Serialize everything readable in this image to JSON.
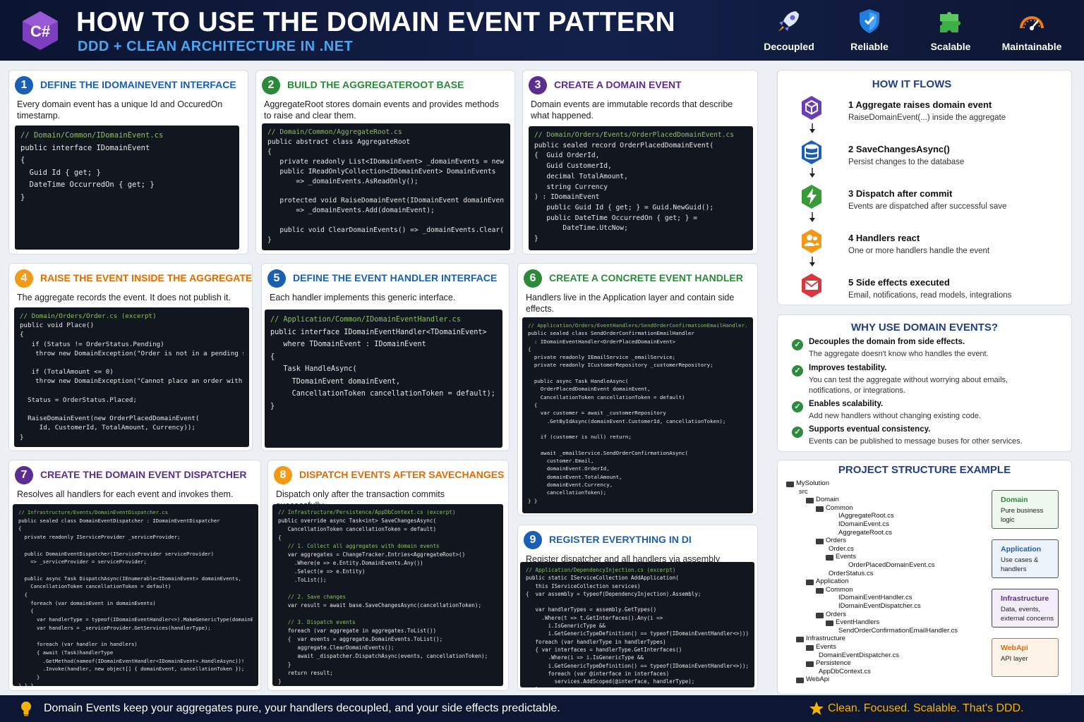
{
  "header": {
    "logo_text": "C#",
    "title": "HOW TO USE THE DOMAIN EVENT PATTERN",
    "subtitle": "DDD + CLEAN ARCHITECTURE IN .NET",
    "badges": [
      {
        "label": "Decoupled",
        "icon": "rocket-icon"
      },
      {
        "label": "Reliable",
        "icon": "shield-icon"
      },
      {
        "label": "Scalable",
        "icon": "puzzle-icon"
      },
      {
        "label": "Maintainable",
        "icon": "gauge-icon"
      }
    ]
  },
  "colors": {
    "blue": "#1a5fb4",
    "green": "#2a8a3a",
    "purple": "#5b2d91",
    "orange": "#e06c00",
    "red": "#c9302c",
    "navy": "#0d1633",
    "gold": "#f4b400"
  },
  "cards": [
    {
      "num": "1",
      "title": "DEFINE THE IDOMAINEVENT INTERFACE",
      "desc": "Every domain event has a unique Id and OccuredOn timestamp.",
      "code": [
        "// Domain/Common/IDomainEvent.cs",
        "public interface IDomainEvent",
        "{",
        "  Guid Id { get; }",
        "  DateTime OccurredOn { get; }",
        "}"
      ]
    },
    {
      "num": "2",
      "title": "BUILD THE AGGREGATEROOT BASE",
      "desc": "AggregateRoot stores domain events and provides methods to raise and clear them.",
      "code": [
        "// Domain/Common/AggregateRoot.cs",
        "public abstract class AggregateRoot",
        "{",
        "   private readonly List<IDomainEvent> _domainEvents = new();",
        "   public IReadOnlyCollection<IDomainEvent> DomainEvents",
        "       => _domainEvents.AsReadOnly();",
        "",
        "   protected void RaiseDomainEvent(IDomainEvent domainEvent)",
        "       => _domainEvents.Add(domainEvent);",
        "",
        "   public void ClearDomainEvents() => _domainEvents.Clear();",
        "}"
      ]
    },
    {
      "num": "3",
      "title": "CREATE A DOMAIN EVENT",
      "desc": "Domain events are immutable records that describe what happened.",
      "code": [
        "// Domain/Orders/Events/OrderPlacedDomainEvent.cs",
        "public sealed record OrderPlacedDomainEvent(",
        "{  Guid OrderId,",
        "   Guid CustomerId,",
        "   decimal TotalAmount,",
        "   string Currency",
        ") : IDomainEvent",
        "   public Guid Id { get; } = Guid.NewGuid();",
        "   public DateTime OccurredOn { get; } =",
        "       DateTime.UtcNow;",
        "}"
      ]
    },
    {
      "num": "4",
      "title": "RAISE THE EVENT INSIDE THE AGGREGATE ROOT",
      "desc": "The aggregate records the event. It does not publish it.",
      "code": [
        "// Domain/Orders/Order.cs (excerpt)",
        "public void Place()",
        "{",
        "   if (Status != OrderStatus.Pending)",
        "    throw new DomainException(\"Order is not in a pending state.\");",
        "",
        "   if (TotalAmount <= 0)",
        "    throw new DomainException(\"Cannot place an order with no items.\");",
        "",
        "  Status = OrderStatus.Placed;",
        "",
        "  RaiseDomainEvent(new OrderPlacedDomainEvent(",
        "     Id, CustomerId, TotalAmount, Currency));",
        "}"
      ]
    },
    {
      "num": "5",
      "title": "DEFINE THE EVENT HANDLER INTERFACE",
      "desc": "Each handler implements this generic interface.",
      "code": [
        "// Application/Common/IDomainEventHandler.cs",
        "public interface IDomainEventHandler<TDomainEvent>",
        "   where TDomainEvent : IDomainEvent",
        "{",
        "   Task HandleAsync(",
        "     TDomainEvent domainEvent,",
        "     CancellationToken cancellationToken = default);",
        "}"
      ]
    },
    {
      "num": "6",
      "title": "CREATE A CONCRETE EVENT HANDLER",
      "desc": "Handlers live in the Application layer and contain side effects.",
      "code": [
        "// Application/Orders/EventHandlers/SendOrderConfirmationEmailHandler.cs",
        "public sealed class SendOrderConfirmationEmailHandler",
        "  : IDomainEventHandler<OrderPlacedDomainEvent>",
        "{",
        "  private readonly IEmailService _emailService;",
        "  private readonly ICustomerRepository _customerRepository;",
        "",
        "  public async Task HandleAsync(",
        "    OrderPlacedDomainEvent domainEvent,",
        "    CancellationToken cancellationToken = default)",
        "  {",
        "    var customer = await _customerRepository",
        "      .GetByIdAsync(domainEvent.CustomerId, cancellationToken);",
        "",
        "    if (customer is null) return;",
        "",
        "    await _emailService.SendOrderConfirmationAsync(",
        "      customer.Email,",
        "      domainEvent.OrderId,",
        "      domainEvent.TotalAmount,",
        "      domainEvent.Currency,",
        "      cancellationToken);",
        "} }"
      ]
    },
    {
      "num": "7",
      "title": "CREATE THE DOMAIN EVENT DISPATCHER",
      "desc": "Resolves all handlers for each event and invokes them.",
      "code": [
        "// Infrastructure/Events/DomainEventDispatcher.cs",
        "public sealed class DomainEventDispatcher : IDomainEventDispatcher",
        "{",
        "  private readonly IServiceProvider _serviceProvider;",
        "",
        "  public DomainEventDispatcher(IServiceProvider serviceProvider)",
        "    => _serviceProvider = serviceProvider;",
        "",
        "  public async Task DispatchAsync(IEnumerable<IDomainEvent> domainEvents,",
        "    CancellationToken cancellationToken = default)",
        "  {",
        "    foreach (var domainEvent in domainEvents)",
        "    {",
        "      var handlerType = typeof(IDomainEventHandler<>).MakeGenericType(domainEvent.GetType());",
        "      var handlers = _serviceProvider.GetServices(handlerType);",
        "",
        "      foreach (var handler in handlers)",
        "      { await (Task)handlerType",
        "        .GetMethod(nameof(IDomainEventHandler<IDomainEvent>.HandleAsync))!",
        "        .Invoke(handler, new object[] { domainEvent, cancellationToken });",
        "      }",
        "} } }"
      ]
    },
    {
      "num": "8",
      "title": "DISPATCH EVENTS AFTER SAVECHANGES",
      "desc": "Dispatch only after the transaction commits successfully.",
      "code": [
        "// Infrastructure/Persistence/AppDbContext.cs (excerpt)",
        "public override async Task<int> SaveChangesAsync(",
        "   CancellationToken cancellationToken = default)",
        "{",
        "   // 1. Collect all aggregates with domain events",
        "   var aggregates = ChangeTracker.Entries<AggregateRoot>()",
        "     .Where(e => e.Entity.DomainEvents.Any())",
        "     .Select(e => e.Entity)",
        "     .ToList();",
        "",
        "   // 2. Save changes",
        "   var result = await base.SaveChangesAsync(cancellationToken);",
        "",
        "   // 3. Dispatch events",
        "   foreach (var aggregate in aggregates.ToList())",
        "   {  var events = aggregate.DomainEvents.ToList();",
        "      aggregate.ClearDomainEvents();",
        "      await _dispatcher.DispatchAsync(events, cancellationToken);",
        "   }",
        "   return result;",
        "}"
      ]
    },
    {
      "num": "9",
      "title": "REGISTER EVERYTHING IN DI",
      "desc": "Register dispatcher and all handlers via assembly scanning.",
      "code": [
        "// Application/DependencyInjection.cs (excerpt)",
        "public static IServiceCollection AddApplication(",
        "   this IServiceCollection services)",
        "{  var assembly = typeof(DependencyInjection).Assembly;",
        "",
        "   var handlerTypes = assembly.GetTypes()",
        "     .Where(t => t.GetInterfaces().Any(i =>",
        "       i.IsGenericType &&",
        "       i.GetGenericTypeDefinition() == typeof(IDomainEventHandler<>)));",
        "   foreach (var handlerType in handlerTypes)",
        "   { var interfaces = handlerType.GetInterfaces()",
        "       .Where(i => i.IsGenericType &&",
        "       i.GetGenericTypeDefinition() == typeof(IDomainEventHandler<>));",
        "       foreach (var @interface in interfaces)",
        "         services.AddScoped(@interface, handlerType);",
        "   }"
      ]
    }
  ],
  "flows": {
    "title": "HOW IT FLOWS",
    "steps": [
      {
        "label": "1  Aggregate raises domain event",
        "desc": "RaiseDomainEvent(...) inside the aggregate",
        "icon": "cube-icon",
        "color": "#6a3fb5"
      },
      {
        "label": "2  SaveChangesAsync()",
        "desc": "Persist changes to the database",
        "icon": "database-icon",
        "color": "#1a5fb4"
      },
      {
        "label": "3  Dispatch after commit",
        "desc": "Events are dispatched after successful save",
        "icon": "lightning-icon",
        "color": "#3a9a3a"
      },
      {
        "label": "4  Handlers react",
        "desc": "One or more handlers handle the event",
        "icon": "users-icon",
        "color": "#f29a17"
      },
      {
        "label": "5  Side effects executed",
        "desc": "Email, notifications, read models, integrations",
        "icon": "mail-icon",
        "color": "#d9363e"
      }
    ]
  },
  "why": {
    "title": "WHY USE DOMAIN EVENTS?",
    "items": [
      {
        "title": "Decouples the domain from side effects.",
        "desc": "The aggregate doesn't know who handles the event."
      },
      {
        "title": "Improves testability.",
        "desc": "You can test the aggregate without worrying about emails, notifications, or integrations."
      },
      {
        "title": "Enables scalability.",
        "desc": "Add new handlers without changing existing code."
      },
      {
        "title": "Supports eventual consistency.",
        "desc": "Events can be published to message buses for other services."
      }
    ]
  },
  "structure": {
    "title": "PROJECT STRUCTURE EXAMPLE",
    "tree": [
      {
        "name": "MySolution",
        "depth": 0,
        "folder": true
      },
      {
        "name": "src",
        "depth": 1,
        "folder": false
      },
      {
        "name": "Domain",
        "depth": 2,
        "folder": true
      },
      {
        "name": "Common",
        "depth": 3,
        "folder": true
      },
      {
        "name": "IAggregateRoot.cs",
        "depth": 5,
        "folder": false
      },
      {
        "name": "IDomainEvent.cs",
        "depth": 5,
        "folder": false
      },
      {
        "name": "AggregateRoot.cs",
        "depth": 5,
        "folder": false
      },
      {
        "name": "Orders",
        "depth": 3,
        "folder": true
      },
      {
        "name": "Order.cs",
        "depth": 4,
        "folder": false
      },
      {
        "name": "Events",
        "depth": 4,
        "folder": true
      },
      {
        "name": "OrderPlacedDomainEvent.cs",
        "depth": 6,
        "folder": false
      },
      {
        "name": "OrderStatus.cs",
        "depth": 4,
        "folder": false
      },
      {
        "name": "Application",
        "depth": 2,
        "folder": true
      },
      {
        "name": "Common",
        "depth": 3,
        "folder": true
      },
      {
        "name": "IDomainEventHandler.cs",
        "depth": 5,
        "folder": false
      },
      {
        "name": "IDomainEventDispatcher.cs",
        "depth": 5,
        "folder": false
      },
      {
        "name": "Orders",
        "depth": 3,
        "folder": true
      },
      {
        "name": "EventHandlers",
        "depth": 4,
        "folder": true
      },
      {
        "name": "SendOrderConfirmationEmailHandler.cs",
        "depth": 5,
        "folder": false
      },
      {
        "name": "Infrastructure",
        "depth": 1,
        "folder": true
      },
      {
        "name": "Events",
        "depth": 2,
        "folder": true
      },
      {
        "name": "DomainEventDispatcher.cs",
        "depth": 3,
        "folder": false
      },
      {
        "name": "Persistence",
        "depth": 2,
        "folder": true
      },
      {
        "name": "AppDbContext.cs",
        "depth": 3,
        "folder": false
      },
      {
        "name": "WebApi",
        "depth": 1,
        "folder": true
      }
    ],
    "layers": [
      {
        "name": "Domain",
        "desc": "Pure business logic",
        "color": "#2a8a3a",
        "bg": "#eef7ee"
      },
      {
        "name": "Application",
        "desc": "Use cases & handlers",
        "color": "#1a5fb4",
        "bg": "#edf3fb"
      },
      {
        "name": "Infrastructure",
        "desc": "Data, events, external concerns",
        "color": "#5b2d91",
        "bg": "#f3eefa"
      },
      {
        "name": "WebApi",
        "desc": "API layer",
        "color": "#e06c00",
        "bg": "#fdf3e7"
      }
    ]
  },
  "footer": {
    "text": "Domain Events keep your aggregates pure, your handlers decoupled, and your side effects predictable.",
    "tagline": "Clean. Focused. Scalable. That's DDD."
  }
}
